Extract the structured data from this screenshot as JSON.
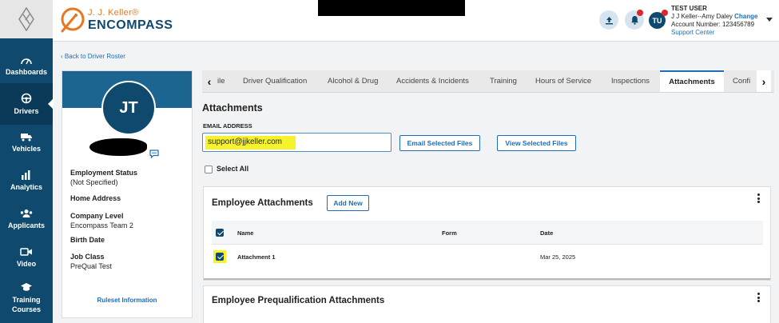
{
  "header": {
    "brand_top": "J. J. Keller®",
    "brand_bottom": "ENCOMPASS",
    "avatar_initials": "TU",
    "user_name": "TEST USER",
    "company_user": "J J Keller--Amy Daley",
    "change_link": "Change",
    "account_label": "Account Number: 123456789",
    "support_link": "Support Center"
  },
  "nav": {
    "items": [
      {
        "label": "Dashboards",
        "icon": "dashboard-icon"
      },
      {
        "label": "Drivers",
        "icon": "steering-wheel-icon"
      },
      {
        "label": "Vehicles",
        "icon": "truck-icon"
      },
      {
        "label": "Analytics",
        "icon": "bar-chart-icon"
      },
      {
        "label": "Applicants",
        "icon": "group-icon"
      },
      {
        "label": "Video",
        "icon": "video-camera-icon"
      },
      {
        "label_line1": "Training",
        "label_line2": "Courses",
        "icon": "graduation-cap-icon"
      }
    ],
    "active": "Drivers"
  },
  "back_link": "Back to Driver Roster",
  "profile": {
    "initials": "JT",
    "fields": [
      {
        "label": "Employment Status",
        "value": "(Not Specified)"
      },
      {
        "label": "Home Address",
        "value": ""
      },
      {
        "label": "Company Level",
        "value": "Encompass Team 2"
      },
      {
        "label": "Birth Date",
        "value": ""
      },
      {
        "label": "Job Class",
        "value": "PreQual Test"
      }
    ],
    "ruleset_link": "Ruleset Information"
  },
  "tabs": {
    "items": [
      "ile",
      "Driver Qualification",
      "Alcohol & Drug",
      "Accidents & Incidents",
      "Training",
      "Hours of Service",
      "Inspections",
      "Attachments",
      "Confi"
    ],
    "active": "Attachments"
  },
  "attachments": {
    "title": "Attachments",
    "email_label": "EMAIL ADDRESS",
    "email_value": "support@jjkeller.com",
    "email_button": "Email Selected Files",
    "view_button": "View Selected Files",
    "select_all": "Select All",
    "select_all_checked": false
  },
  "employee_attachments": {
    "title": "Employee Attachments",
    "add_new": "Add New",
    "columns": [
      "Name",
      "Form",
      "Date"
    ],
    "rows": [
      {
        "name": "Attachment 1",
        "form": "",
        "date": "Mar 25, 2025",
        "checked": true
      }
    ]
  },
  "prequal_attachments": {
    "title": "Employee Prequalification Attachments"
  },
  "colors": {
    "nav_bg": "#0f4a6e",
    "accent": "#1e6db6",
    "brand_orange": "#e87722",
    "highlight": "#f7f32a",
    "notification": "#e0262b"
  }
}
